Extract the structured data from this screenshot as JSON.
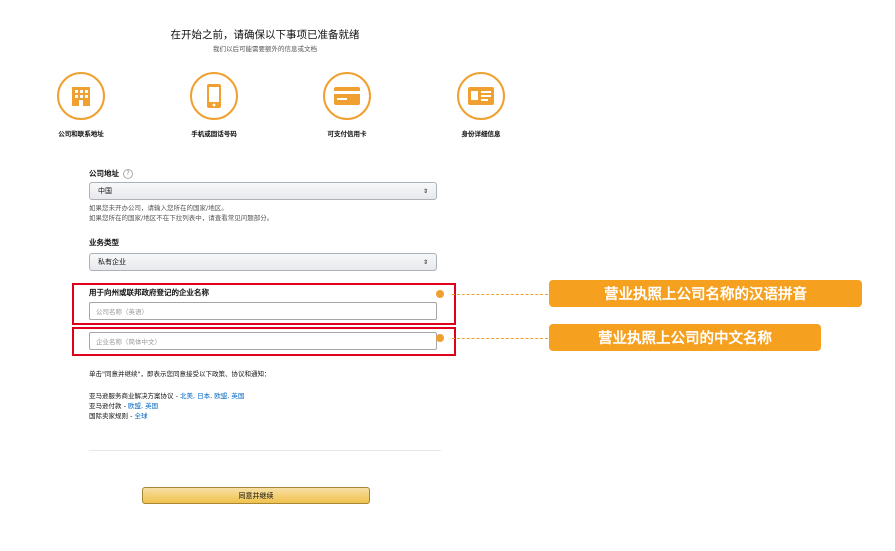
{
  "header": {
    "title": "在开始之前，请确保以下事项已准备就绪",
    "subtitle": "我们以后可能需要额外的信息或文档"
  },
  "steps": [
    {
      "label": "公司和联系地址",
      "icon": "building-icon"
    },
    {
      "label": "手机或固话号码",
      "icon": "mobile-phone-icon"
    },
    {
      "label": "可支付信用卡",
      "icon": "credit-card-icon"
    },
    {
      "label": "身份详细信息",
      "icon": "id-card-icon"
    }
  ],
  "address": {
    "label": "公司地址",
    "help_icon": "help-icon",
    "selected": "中国",
    "help_line1": "如果您未开办公司，请输入您所在的国家/地区。",
    "help_line2": "如果您所在的国家/地区不在下拉列表中，请查看常见问题部分。"
  },
  "business_type": {
    "label": "业务类型",
    "selected": "私有企业"
  },
  "company_name": {
    "label": "用于向州或联邦政府登记的企业名称",
    "en_placeholder": "公司名称（英语）",
    "cn_placeholder": "企业名称（简体中文）"
  },
  "callouts": {
    "pinyin": "营业执照上公司名称的汉语拼音",
    "chinese": "营业执照上公司的中文名称"
  },
  "agreement": {
    "intro": "单击\"同意并继续\"，即表示您同意接受以下政策、协议和通知：",
    "line1_text": "亚马逊服务商业解决方案协议 - ",
    "line1_links": "北美, 日本, 欧盟, 英国",
    "line2_text": "亚马逊付款 - ",
    "line2_links": "欧盟, 英国",
    "line3_text": "国际卖家规则 - ",
    "line3_links": "全球"
  },
  "submit": {
    "label": "同意并继续"
  },
  "colors": {
    "accent": "#f0a030",
    "highlight": "#e0001b",
    "link": "#0066c0",
    "callout": "#f6a020"
  }
}
